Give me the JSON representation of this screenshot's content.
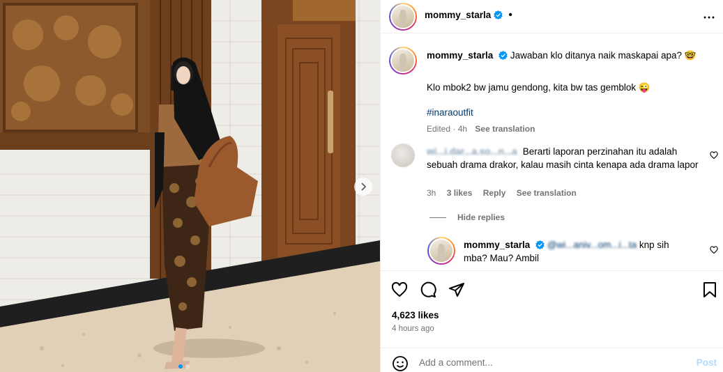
{
  "post": {
    "username": "mommy_starla",
    "header_dot": "•",
    "caption_line1": "Jawaban klo ditanya naik maskapai apa? 🤓",
    "caption_line2": "Klo mbok2 bw jamu gendong, kita bw tas gemblok 😜",
    "hashtag": "#inaraoutfit",
    "edited": "Edited · 4h",
    "see_translation": "See translation"
  },
  "comment1": {
    "username_blurred": "wi...i.dar...a.so...n...a",
    "text": "Berarti laporan perzinahan itu adalah sebuah drama drakor, kalau masih cinta kenapa ada drama lapor",
    "time": "3h",
    "likes": "3 likes",
    "reply": "Reply",
    "see_translation": "See translation",
    "hide_replies": "Hide replies"
  },
  "reply": {
    "username": "mommy_starla",
    "mention_blurred": "@wi...aniv...om...i...ta",
    "text": "knp sih mba? Mau? Ambil"
  },
  "actions": {
    "likes": "4,623 likes",
    "time_ago": "4 hours ago",
    "comment_placeholder": "Add a comment...",
    "post_label": "Post"
  },
  "colors": {
    "verified": "#0095f6",
    "link": "#00376b",
    "secondary_text": "#737373",
    "post_button_disabled": "#b3dbff"
  },
  "icons": [
    "verified-badge-icon",
    "more-options-icon",
    "heart-icon",
    "comment-icon",
    "share-icon",
    "bookmark-icon",
    "emoji-icon",
    "chevron-right-icon"
  ]
}
